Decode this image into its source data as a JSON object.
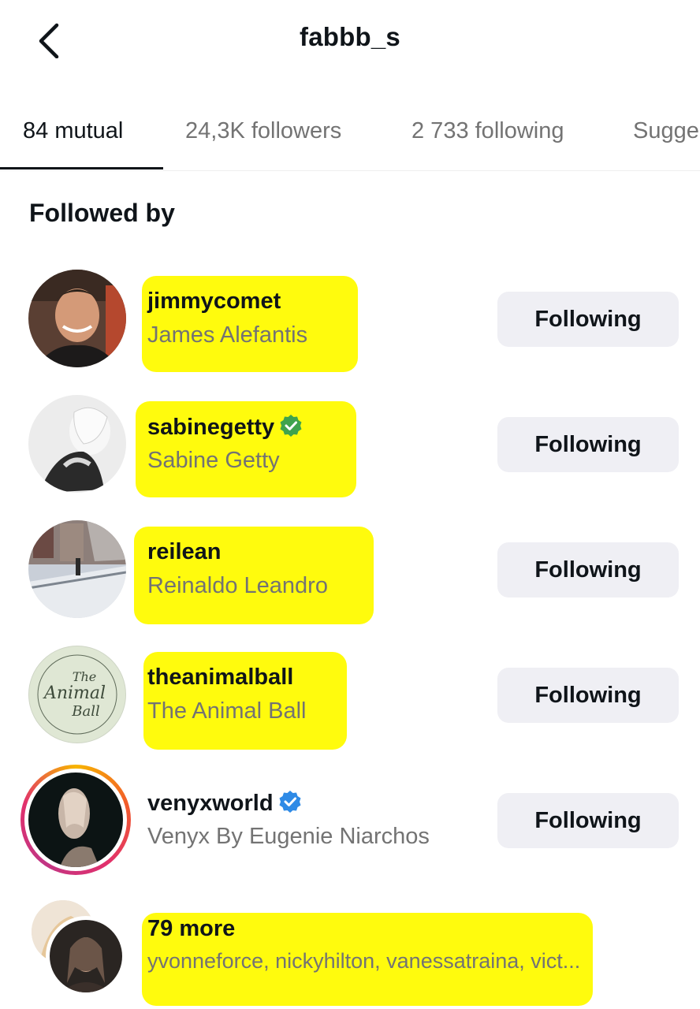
{
  "header": {
    "title": "fabbb_s"
  },
  "tabs": [
    {
      "label": "84 mutual",
      "active": true
    },
    {
      "label": "24,3K followers",
      "active": false
    },
    {
      "label": "2 733 following",
      "active": false
    },
    {
      "label": "Sugge",
      "active": false
    }
  ],
  "section_title": "Followed by",
  "users": [
    {
      "username": "jimmycomet",
      "full_name": "James Alefantis",
      "verified": false,
      "button_label": "Following"
    },
    {
      "username": "sabinegetty",
      "full_name": "Sabine Getty",
      "verified": true,
      "verified_color": "#3fa34d",
      "button_label": "Following"
    },
    {
      "username": "reilean",
      "full_name": "Reinaldo Leandro",
      "verified": false,
      "button_label": "Following"
    },
    {
      "username": "theanimalball",
      "full_name": "The Animal Ball",
      "verified": false,
      "button_label": "Following"
    },
    {
      "username": "venyxworld",
      "full_name": "Venyx By Eugenie Niarchos",
      "verified": true,
      "verified_color": "#2e8ae6",
      "button_label": "Following"
    }
  ],
  "more": {
    "title": "79 more",
    "subtitle": "yvonneforce, nickyhilton, vanessatraina, vict..."
  },
  "avatar_logo": {
    "line1": "The",
    "line2": "Animal",
    "line3": "Ball"
  },
  "colors": {
    "highlight": "#fffb00",
    "button_bg": "#efeff4",
    "muted_text": "#737373"
  }
}
